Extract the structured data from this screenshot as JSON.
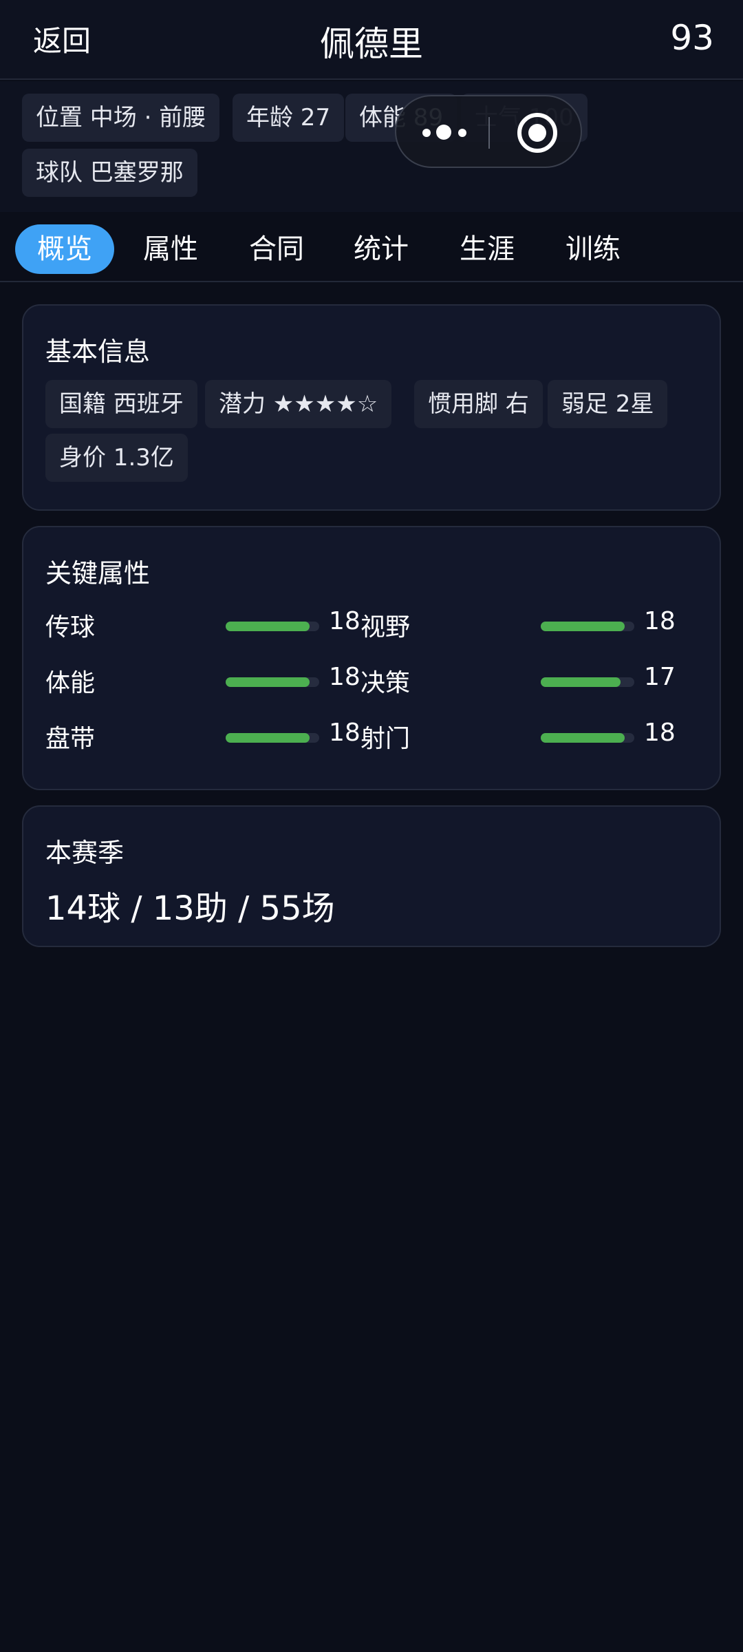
{
  "header": {
    "back_label": "返回",
    "title": "佩德里",
    "rating": "93"
  },
  "tags": {
    "position": "位置 中场 · 前腰",
    "age": "年龄 27",
    "stamina": "体能 89",
    "morale": "士气 100",
    "team": "球队 巴塞罗那"
  },
  "tabs": [
    "概览",
    "属性",
    "合同",
    "统计",
    "生涯",
    "训练"
  ],
  "active_tab": "概览",
  "basic_info": {
    "title": "基本信息",
    "tags": [
      "国籍 西班牙",
      "潜力 ★★★★☆",
      "惯用脚 右",
      "弱足 2星",
      "身价 1.3亿"
    ]
  },
  "key_attributes": {
    "title": "关键属性",
    "max": 20,
    "rows": [
      [
        {
          "label": "传球",
          "value": "18"
        },
        {
          "label": "视野",
          "value": "18"
        }
      ],
      [
        {
          "label": "体能",
          "value": "18"
        },
        {
          "label": "决策",
          "value": "17"
        }
      ],
      [
        {
          "label": "盘带",
          "value": "18"
        },
        {
          "label": "射门",
          "value": "18"
        }
      ]
    ]
  },
  "season": {
    "title": "本赛季",
    "summary": "14球 / 13助 / 55场"
  },
  "colors": {
    "background": "#0b0e19",
    "accent": "#3fa2f5",
    "bar_fill": "#4caf50",
    "card": "#12172a"
  }
}
